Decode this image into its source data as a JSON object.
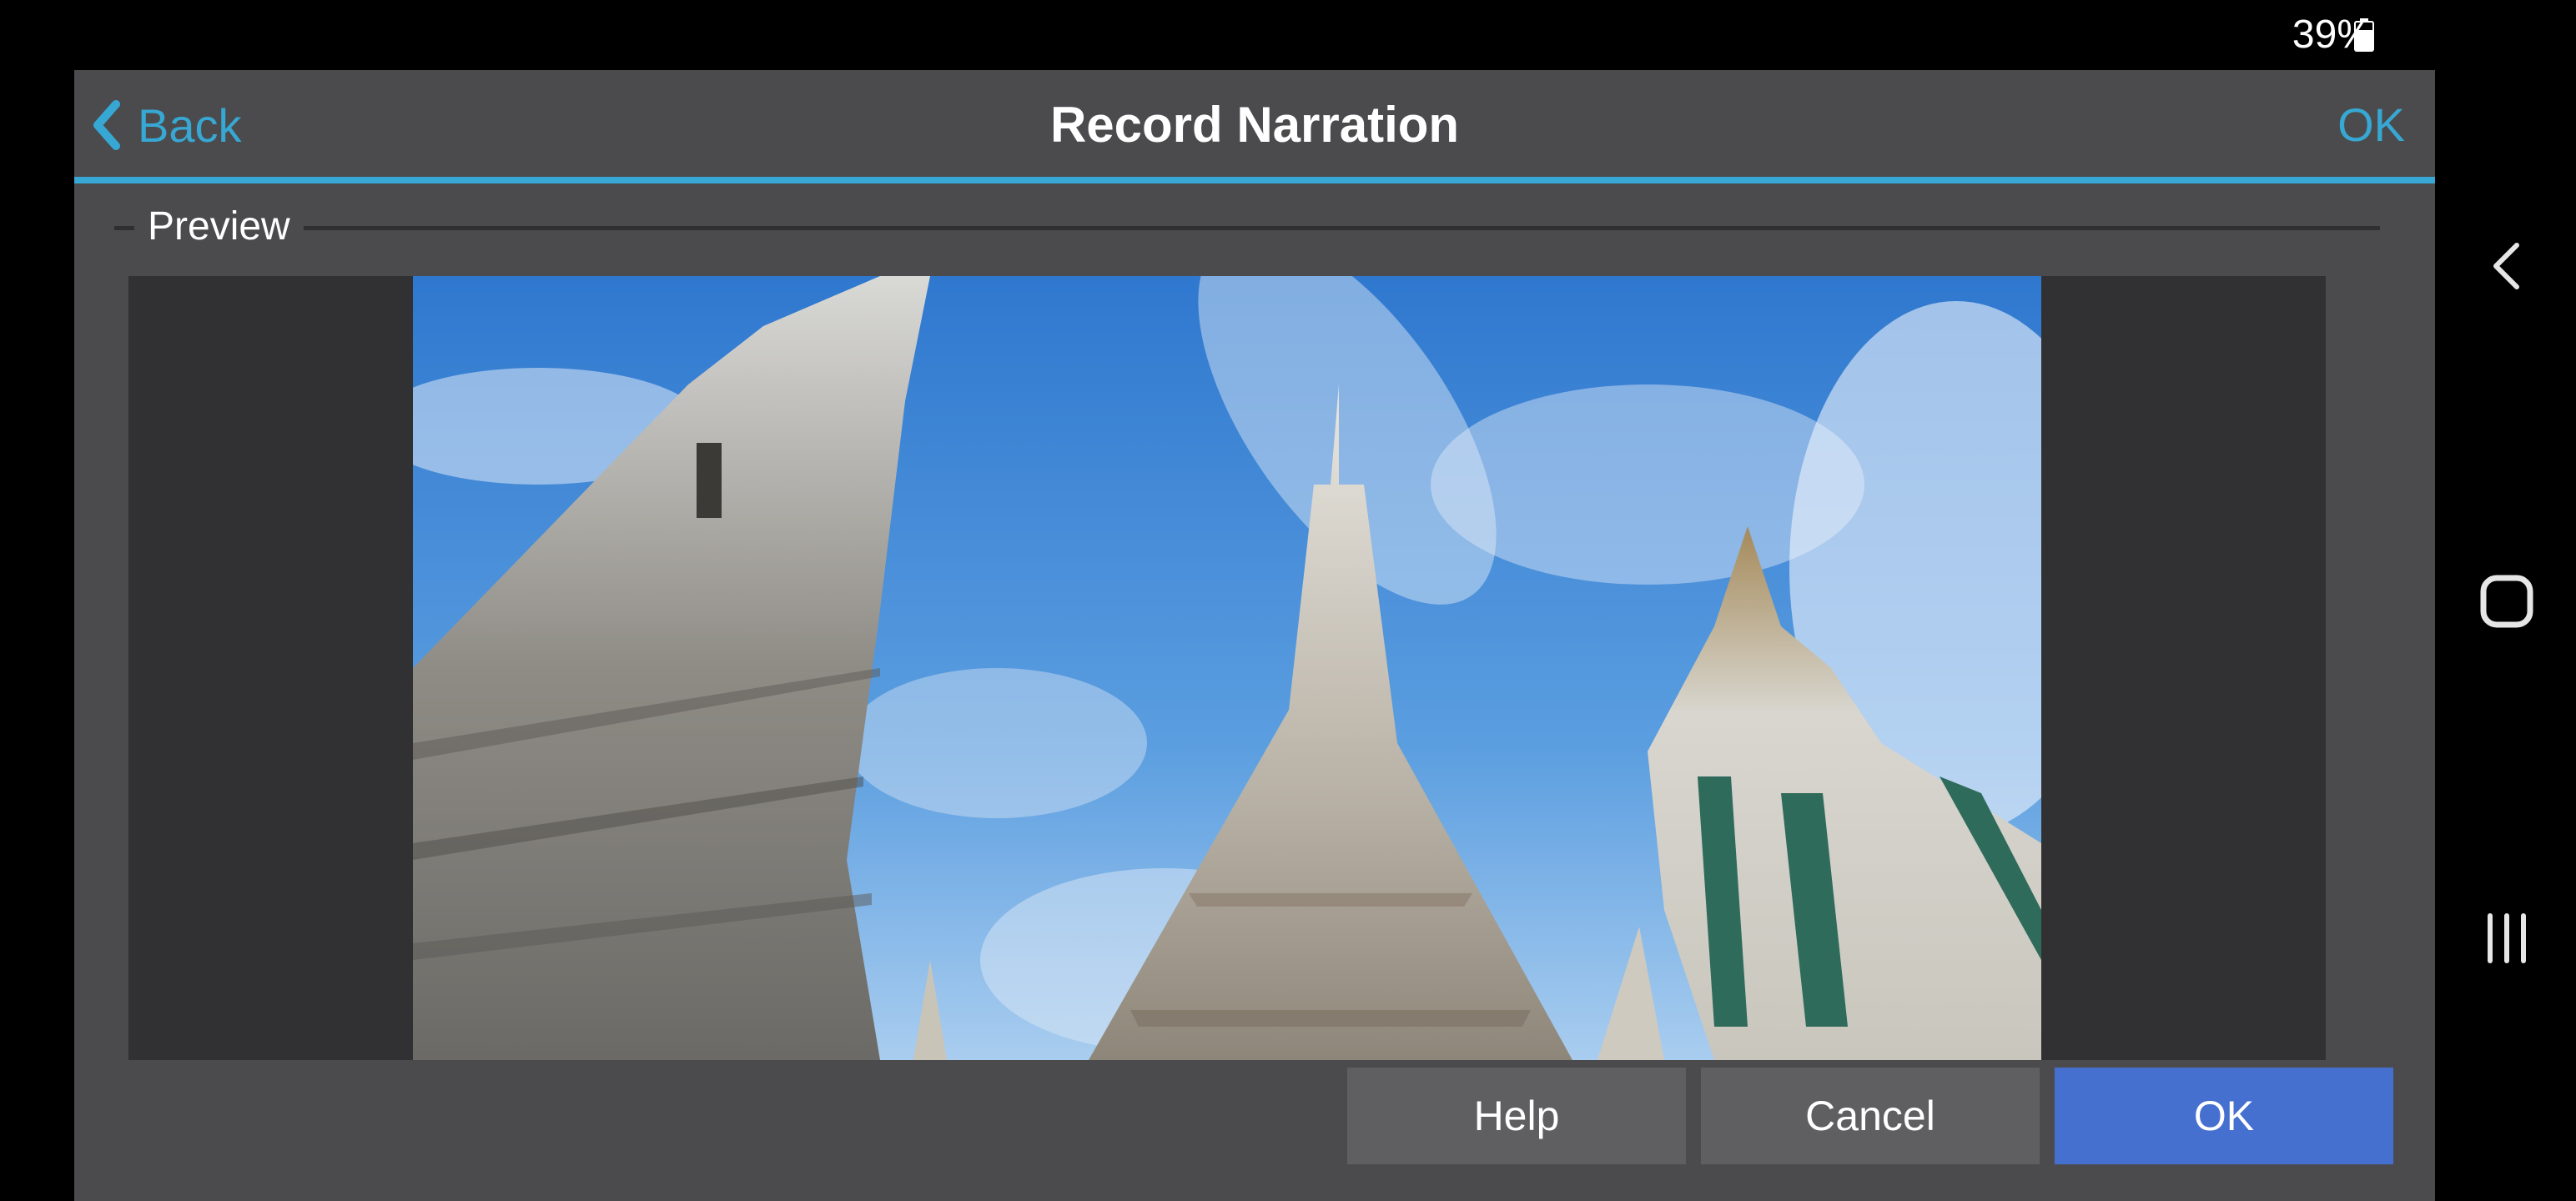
{
  "status_bar": {
    "battery_percent": "39%",
    "battery_icon": "battery-icon"
  },
  "navigation": {
    "back_icon": "chevron-left-icon",
    "home_icon": "rounded-square-icon",
    "recents_icon": "three-bars-icon"
  },
  "header": {
    "back_label": "Back",
    "title": "Record Narration",
    "ok_label": "OK"
  },
  "preview": {
    "group_label": "Preview"
  },
  "buttons": {
    "help": "Help",
    "cancel": "Cancel",
    "ok": "OK"
  },
  "colors": {
    "accent": "#37a7d3",
    "primary_button": "#4670d0",
    "secondary_button": "#5f5f61",
    "dialog_background": "#4b4b4d",
    "preview_letterbox": "#313133"
  }
}
